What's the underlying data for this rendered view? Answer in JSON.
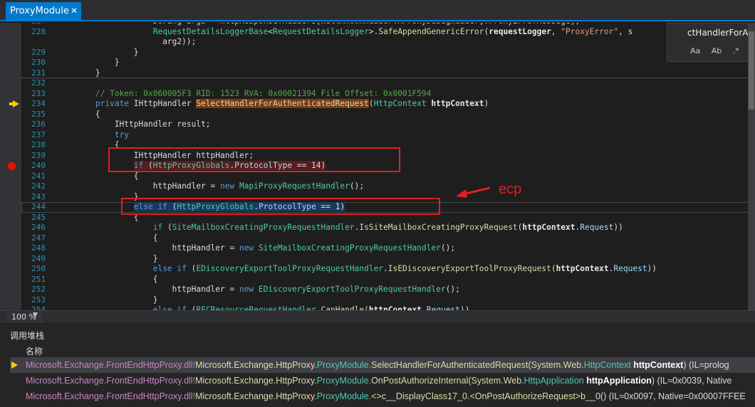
{
  "tab": {
    "title": "ProxyModule",
    "close": "✕"
  },
  "find": {
    "query": "ctHandlerForAuth",
    "opt_case": "Aa",
    "opt_word": "Ab",
    "opt_regex": ".*"
  },
  "editor": {
    "lines": [
      {
        "n": "227",
        "segs": [
          {
            "t": "                    ",
            "c": ""
          },
          {
            "t": "DoPing args = HttpResponse.Headers[WellKnownHeader.XProxyDebugHeader].ProxyErrorMessage];",
            "c": ""
          }
        ]
      },
      {
        "n": "228",
        "segs": [
          {
            "t": "                    ",
            "c": ""
          },
          {
            "t": "RequestDetailsLoggerBase",
            "c": "ty"
          },
          {
            "t": "<",
            "c": ""
          },
          {
            "t": "RequestDetailsLogger",
            "c": "ty"
          },
          {
            "t": ">.",
            "c": ""
          },
          {
            "t": "SafeAppendGenericError",
            "c": "mt"
          },
          {
            "t": "(",
            "c": ""
          },
          {
            "t": "requestLogger",
            "c": "bd"
          },
          {
            "t": ", ",
            "c": ""
          },
          {
            "t": "\"ProxyError\"",
            "c": "st"
          },
          {
            "t": ", s",
            "c": ""
          }
        ]
      },
      {
        "n": "",
        "segs": [
          {
            "t": "                      arg2));",
            "c": ""
          }
        ]
      },
      {
        "n": "229",
        "segs": [
          {
            "t": "                }",
            "c": ""
          }
        ]
      },
      {
        "n": "230",
        "segs": [
          {
            "t": "            }",
            "c": ""
          }
        ]
      },
      {
        "n": "231",
        "segs": [
          {
            "t": "        }",
            "c": ""
          }
        ]
      },
      {
        "n": "232",
        "segs": [
          {
            "t": "",
            "c": ""
          }
        ]
      },
      {
        "n": "233",
        "segs": [
          {
            "t": "        ",
            "c": ""
          },
          {
            "t": "// Token: 0x060005F3 RID: 1523 RVA: 0x00021394 File Offset: 0x0001F594",
            "c": "cm"
          }
        ]
      },
      {
        "n": "234",
        "segs": [
          {
            "t": "        ",
            "c": ""
          },
          {
            "t": "private ",
            "c": "kw"
          },
          {
            "t": "IHttpHandler ",
            "c": ""
          },
          {
            "t": "SelectHandlerForAuthenticatedRequest",
            "c": "hlname"
          },
          {
            "t": "(",
            "c": ""
          },
          {
            "t": "HttpContext ",
            "c": "ty"
          },
          {
            "t": "httpContext",
            "c": "bd"
          },
          {
            "t": ")",
            "c": ""
          }
        ]
      },
      {
        "n": "235",
        "segs": [
          {
            "t": "        {",
            "c": ""
          }
        ]
      },
      {
        "n": "236",
        "segs": [
          {
            "t": "            IHttpHandler result;",
            "c": ""
          }
        ]
      },
      {
        "n": "237",
        "segs": [
          {
            "t": "            ",
            "c": ""
          },
          {
            "t": "try",
            "c": "kw"
          }
        ]
      },
      {
        "n": "238",
        "segs": [
          {
            "t": "            {",
            "c": ""
          }
        ]
      },
      {
        "n": "239",
        "segs": [
          {
            "t": "                IHttpHandler httpHandler;",
            "c": ""
          }
        ]
      },
      {
        "n": "240",
        "segs": [
          {
            "t": "                ",
            "c": ""
          },
          {
            "t": "if ",
            "c": "kw"
          },
          {
            "t": "(",
            "c": ""
          },
          {
            "t": "HttpProxyGlobals",
            "c": "ty"
          },
          {
            "t": ".",
            "c": ""
          },
          {
            "t": "ProtocolType",
            "c": "pa"
          },
          {
            "t": " == 14)",
            "c": ""
          }
        ]
      },
      {
        "n": "241",
        "segs": [
          {
            "t": "                {",
            "c": ""
          }
        ]
      },
      {
        "n": "242",
        "segs": [
          {
            "t": "                    httpHandler = ",
            "c": ""
          },
          {
            "t": "new ",
            "c": "kw"
          },
          {
            "t": "MapiProxyRequestHandler",
            "c": "ty"
          },
          {
            "t": "();",
            "c": ""
          }
        ]
      },
      {
        "n": "243",
        "segs": [
          {
            "t": "                }",
            "c": ""
          }
        ]
      },
      {
        "n": "244",
        "segs": [
          {
            "t": "                ",
            "c": ""
          },
          {
            "t": "else if ",
            "c": "kw"
          },
          {
            "t": "(",
            "c": ""
          },
          {
            "t": "HttpProxyGlobals",
            "c": "ty"
          },
          {
            "t": ".",
            "c": ""
          },
          {
            "t": "ProtocolType",
            "c": "pa"
          },
          {
            "t": " == 1)",
            "c": ""
          }
        ]
      },
      {
        "n": "245",
        "segs": [
          {
            "t": "                {",
            "c": ""
          }
        ]
      },
      {
        "n": "246",
        "segs": [
          {
            "t": "                    ",
            "c": ""
          },
          {
            "t": "if ",
            "c": "kw"
          },
          {
            "t": "(",
            "c": ""
          },
          {
            "t": "SiteMailboxCreatingProxyRequestHandler",
            "c": "ty"
          },
          {
            "t": ".",
            "c": ""
          },
          {
            "t": "IsSiteMailboxCreatingProxyRequest",
            "c": "mt"
          },
          {
            "t": "(",
            "c": ""
          },
          {
            "t": "httpContext",
            "c": "bd"
          },
          {
            "t": ".",
            "c": ""
          },
          {
            "t": "Request",
            "c": "pa"
          },
          {
            "t": "))",
            "c": ""
          }
        ]
      },
      {
        "n": "247",
        "segs": [
          {
            "t": "                    {",
            "c": ""
          }
        ]
      },
      {
        "n": "248",
        "segs": [
          {
            "t": "                        httpHandler = ",
            "c": ""
          },
          {
            "t": "new ",
            "c": "kw"
          },
          {
            "t": "SiteMailboxCreatingProxyRequestHandler",
            "c": "ty"
          },
          {
            "t": "();",
            "c": ""
          }
        ]
      },
      {
        "n": "249",
        "segs": [
          {
            "t": "                    }",
            "c": ""
          }
        ]
      },
      {
        "n": "250",
        "segs": [
          {
            "t": "                    ",
            "c": ""
          },
          {
            "t": "else if ",
            "c": "kw"
          },
          {
            "t": "(",
            "c": ""
          },
          {
            "t": "EDiscoveryExportToolProxyRequestHandler",
            "c": "ty"
          },
          {
            "t": ".",
            "c": ""
          },
          {
            "t": "IsEDiscoveryExportToolProxyRequest",
            "c": "mt"
          },
          {
            "t": "(",
            "c": ""
          },
          {
            "t": "httpContext",
            "c": "bd"
          },
          {
            "t": ".",
            "c": ""
          },
          {
            "t": "Request",
            "c": "pa"
          },
          {
            "t": "))",
            "c": ""
          }
        ]
      },
      {
        "n": "251",
        "segs": [
          {
            "t": "                    {",
            "c": ""
          }
        ]
      },
      {
        "n": "252",
        "segs": [
          {
            "t": "                        httpHandler = ",
            "c": ""
          },
          {
            "t": "new ",
            "c": "kw"
          },
          {
            "t": "EDiscoveryExportToolProxyRequestHandler",
            "c": "ty"
          },
          {
            "t": "();",
            "c": ""
          }
        ]
      },
      {
        "n": "253",
        "segs": [
          {
            "t": "                    }",
            "c": ""
          }
        ]
      },
      {
        "n": "254",
        "segs": [
          {
            "t": "                    ",
            "c": ""
          },
          {
            "t": "else if ",
            "c": "kw"
          },
          {
            "t": "(",
            "c": ""
          },
          {
            "t": "RFCResourceRequestHandler",
            "c": "ty"
          },
          {
            "t": ".",
            "c": ""
          },
          {
            "t": "CanHandle",
            "c": "mt"
          },
          {
            "t": "(",
            "c": ""
          },
          {
            "t": "httpContext",
            "c": "bd"
          },
          {
            "t": ".",
            "c": ""
          },
          {
            "t": "Request",
            "c": "pa"
          },
          {
            "t": "))",
            "c": ""
          }
        ]
      }
    ]
  },
  "annotation": {
    "label": "ecp",
    "color": "#e02020"
  },
  "zoom": {
    "value": "100 %"
  },
  "callstack": {
    "title": "调用堆栈",
    "column": "名称",
    "rows": [
      {
        "module": "Microsoft.Exchange.FrontEndHttpProxy.dll!",
        "ns": "Microsoft.Exchange.HttpProxy.",
        "cls": "ProxyModule.",
        "method": "SelectHandlerForAuthenticatedRequest",
        "args_open": "(",
        "argtype_ns": "System.Web.",
        "argtype": "HttpContext",
        "argname": " httpContext",
        "rest": ") (IL=prolog"
      },
      {
        "module": "Microsoft.Exchange.FrontEndHttpProxy.dll!",
        "ns": "Microsoft.Exchange.HttpProxy.",
        "cls": "ProxyModule.",
        "method": "OnPostAuthorizeInternal",
        "args_open": "(",
        "argtype_ns": "System.Web.",
        "argtype": "HttpApplication",
        "argname": " httpApplication",
        "rest": ") (IL≈0x0039, Native"
      },
      {
        "module": "Microsoft.Exchange.FrontEndHttpProxy.dll!",
        "ns": "Microsoft.Exchange.HttpProxy.",
        "cls": "ProxyModule.",
        "method": "<>c__DisplayClass17_0.<OnPostAuthorizeRequest>b__0",
        "args_open": "(",
        "argtype_ns": "",
        "argtype": "",
        "argname": "",
        "rest": ") (IL≈0x0097, Native=0x00007FFEE"
      }
    ]
  }
}
